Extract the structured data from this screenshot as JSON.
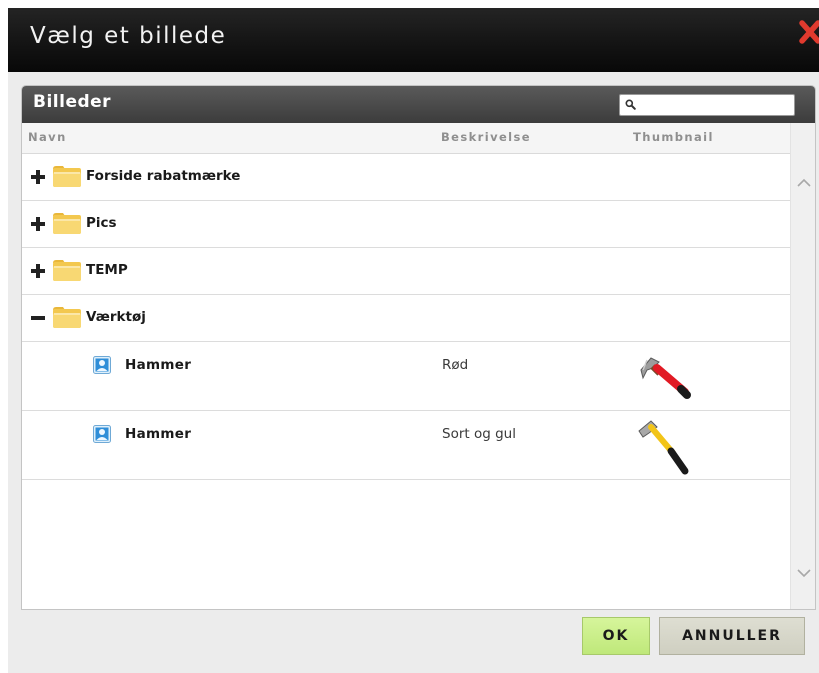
{
  "dialog": {
    "title": "Vælg et billede",
    "close_icon": "close-x-icon",
    "close_color": "#e03a2e"
  },
  "panel": {
    "title": "Billeder",
    "search": {
      "value": "",
      "placeholder": "",
      "icon": "search-icon"
    }
  },
  "columns": {
    "name": "Navn",
    "description": "Beskrivelse",
    "thumbnail": "Thumbnail"
  },
  "tree": {
    "folders": [
      {
        "label": "Forside rabatmærke",
        "state": "collapsed",
        "toggle_icon": "plus-icon"
      },
      {
        "label": "Pics",
        "state": "collapsed",
        "toggle_icon": "plus-icon"
      },
      {
        "label": "TEMP",
        "state": "collapsed",
        "toggle_icon": "plus-icon"
      },
      {
        "label": "Værktøj",
        "state": "expanded",
        "toggle_icon": "minus-icon"
      }
    ],
    "items": [
      {
        "name": "Hammer",
        "description": "Rød",
        "thumbnail": "red-hammer-thumbnail"
      },
      {
        "name": "Hammer",
        "description": "Sort og gul",
        "thumbnail": "yellow-black-hammer-thumbnail"
      }
    ]
  },
  "buttons": {
    "ok": "OK",
    "cancel": "ANNULLER"
  },
  "colors": {
    "ok_button": "#c8ee84",
    "cancel_button": "#d6d6c8",
    "titlebar": "#141414",
    "panel_header": "#4a4a4a",
    "folder": "#f5c542"
  }
}
